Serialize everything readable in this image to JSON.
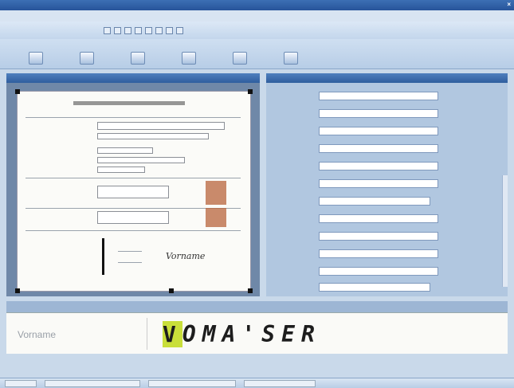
{
  "window": {
    "title": "",
    "close_glyph": "×"
  },
  "menu": [
    "",
    "",
    "",
    "",
    ""
  ],
  "ribbon": {
    "buttons": [
      {
        "name": "ribbon-button-1",
        "label": ""
      },
      {
        "name": "ribbon-button-2",
        "label": ""
      },
      {
        "name": "ribbon-button-3",
        "label": ""
      },
      {
        "name": "ribbon-button-4",
        "label": ""
      },
      {
        "name": "ribbon-button-5",
        "label": ""
      },
      {
        "name": "ribbon-button-6",
        "label": ""
      }
    ]
  },
  "document": {
    "signature_text": "Vorname"
  },
  "form": {
    "fields": [
      {
        "label": "",
        "value": ""
      },
      {
        "label": "",
        "value": ""
      },
      {
        "label": "",
        "value": ""
      },
      {
        "label": "",
        "value": ""
      },
      {
        "label": "",
        "value": ""
      },
      {
        "label": "",
        "value": ""
      },
      {
        "label": "",
        "value": ""
      },
      {
        "label": "",
        "value": ""
      },
      {
        "label": "",
        "value": ""
      },
      {
        "label": "",
        "value": ""
      },
      {
        "label": "",
        "value": ""
      },
      {
        "label": "",
        "value": ""
      }
    ]
  },
  "zoom_field": {
    "label": "Vorname",
    "first_char": "V",
    "rest_value": "OMA'SER"
  },
  "colors": {
    "accent": "#2f5e9e",
    "highlight": "#c9df3a"
  }
}
